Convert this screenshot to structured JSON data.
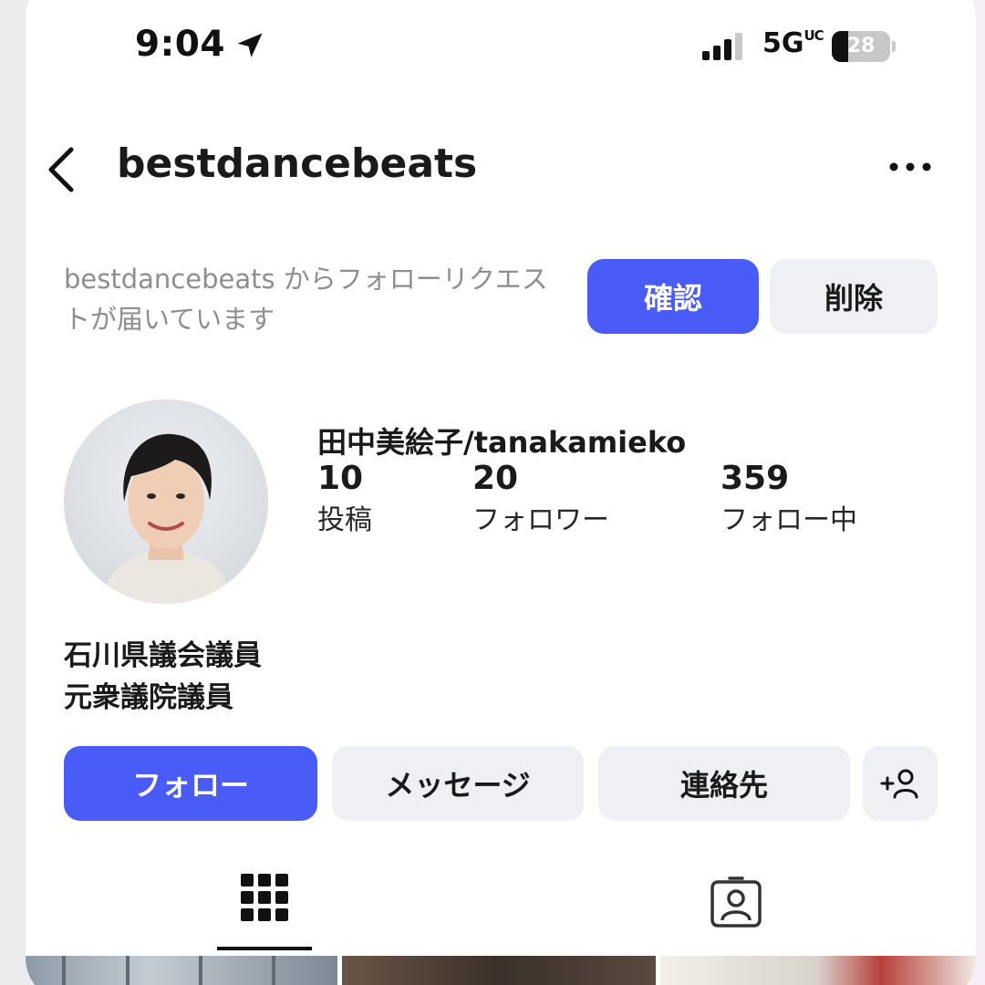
{
  "status_bar": {
    "time": "9:04",
    "network": "5G",
    "network_sub": "UC",
    "battery": "28",
    "battery_level": 0.28
  },
  "header": {
    "username": "bestdancebeats"
  },
  "follow_request": {
    "text": "bestdancebeats からフォローリクエストが届いています",
    "confirm_label": "確認",
    "delete_label": "削除"
  },
  "profile": {
    "display_name": "田中美絵子/tanakamieko",
    "stats": [
      {
        "value": "10",
        "label": "投稿"
      },
      {
        "value": "20",
        "label": "フォロワー"
      },
      {
        "value": "359",
        "label": "フォロー中"
      }
    ],
    "bio": [
      "石川県議会議員",
      "元衆議院議員"
    ]
  },
  "actions": {
    "follow_label": "フォロー",
    "message_label": "メッセージ",
    "contact_label": "連絡先",
    "add_friend_icon": "add-person-icon"
  },
  "tabs": [
    {
      "icon": "grid-icon",
      "active": true
    },
    {
      "icon": "tagged-person-icon",
      "active": false
    }
  ],
  "colors": {
    "primary": "#4a5cf7",
    "secondary_button": "#eff0f3",
    "muted_text": "#8e8e8e"
  }
}
